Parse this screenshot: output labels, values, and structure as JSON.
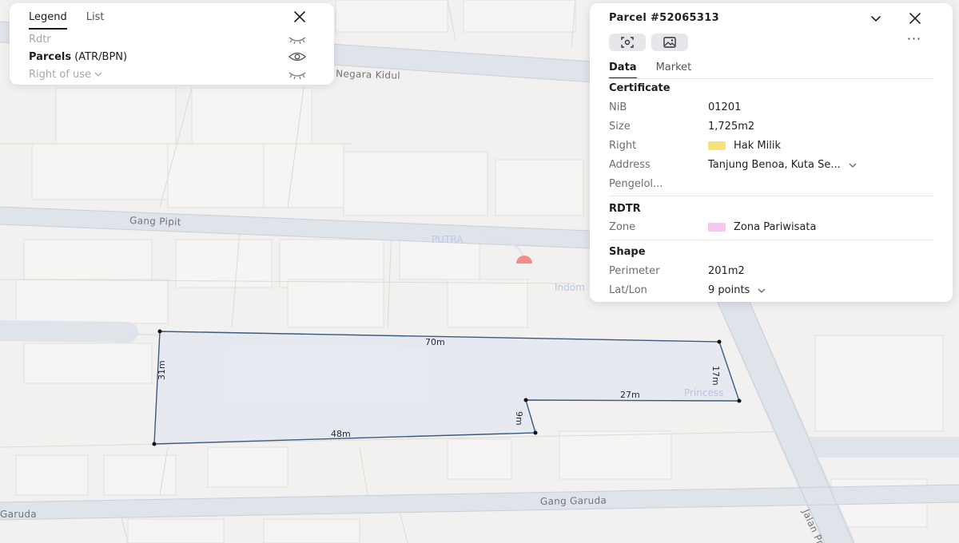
{
  "legend": {
    "tabs": [
      {
        "label": "Legend",
        "active": true
      },
      {
        "label": "List",
        "active": false
      }
    ],
    "layers": [
      {
        "label": "Rdtr",
        "visible": false
      },
      {
        "label_strong": "Parcels",
        "label_rest": " (ATR/BPN)",
        "visible": true
      },
      {
        "label": "Right of use",
        "visible": false
      }
    ],
    "icons": {
      "close": "close-icon",
      "visible": "eye-icon",
      "hidden": "eye-closed-icon"
    }
  },
  "parcel": {
    "title": "Parcel #52065313",
    "tabs": [
      {
        "label": "Data",
        "active": true
      },
      {
        "label": "Market",
        "active": false
      }
    ],
    "certificate": {
      "heading": "Certificate",
      "nib_label": "NiB",
      "nib_value": "01201",
      "size_label": "Size",
      "size_value": "1,725m2",
      "right_label": "Right",
      "right_value": "Hak Milik",
      "right_color": "#f6e27a",
      "address_label": "Address",
      "address_value": "Tanjung Benoa, Kuta Se...",
      "pengelola_label": "Pengelol..."
    },
    "rdtr": {
      "heading": "RDTR",
      "zone_label": "Zone",
      "zone_value": "Zona Pariwisata",
      "zone_color": "#f9c6f0"
    },
    "shape": {
      "heading": "Shape",
      "perimeter_label": "Perimeter",
      "perimeter_value": "201m2",
      "latlon_label": "Lat/Lon",
      "latlon_value": "9 points"
    },
    "icons": {
      "collapse": "chevron-down-icon",
      "close": "close-icon",
      "focus": "focus-icon",
      "image": "image-icon",
      "more": "more-icon"
    }
  },
  "map": {
    "streets": [
      "Negara Kidul",
      "Gang Pipit",
      "Gang Garuda",
      "Garuda",
      "Jalan Pr"
    ],
    "pois": [
      "PUTRA",
      "Indom",
      "Princess"
    ],
    "edge_lengths": [
      "70m",
      "17m",
      "27m",
      "9m",
      "48m",
      "31m"
    ],
    "parcel_fill": "#e4e7ee",
    "parcel_stroke": "#3a5a80"
  }
}
